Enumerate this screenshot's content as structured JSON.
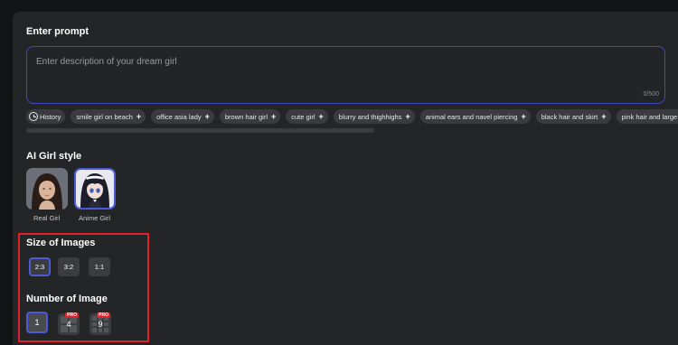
{
  "prompt": {
    "title": "Enter prompt",
    "placeholder": "Enter description of your dream girl",
    "counter": "0/500"
  },
  "tags": {
    "history_label": "History",
    "items": [
      "smile girl on beach",
      "office asia lady",
      "brown hair girl",
      "cute girl",
      "blurry and thighhighs",
      "animal ears and navel piercing",
      "black hair and skirt",
      "pink hair and large breasts"
    ]
  },
  "style": {
    "title": "AI Girl style",
    "options": [
      {
        "label": "Real Girl",
        "selected": false
      },
      {
        "label": "Anime Girl",
        "selected": true
      }
    ]
  },
  "size": {
    "title": "Size of Images",
    "options": [
      {
        "label": "2:3",
        "selected": true
      },
      {
        "label": "3:2",
        "selected": false
      },
      {
        "label": "1:1",
        "selected": false
      }
    ]
  },
  "number": {
    "title": "Number of Image",
    "options": [
      {
        "label": "1",
        "selected": true,
        "pro": false
      },
      {
        "label": "4",
        "selected": false,
        "pro": true
      },
      {
        "label": "9",
        "selected": false,
        "pro": true
      }
    ],
    "pro_badge": "PRO"
  },
  "colors": {
    "accent": "#4a5ad8",
    "highlight": "#e0202a",
    "panel": "#242527"
  }
}
